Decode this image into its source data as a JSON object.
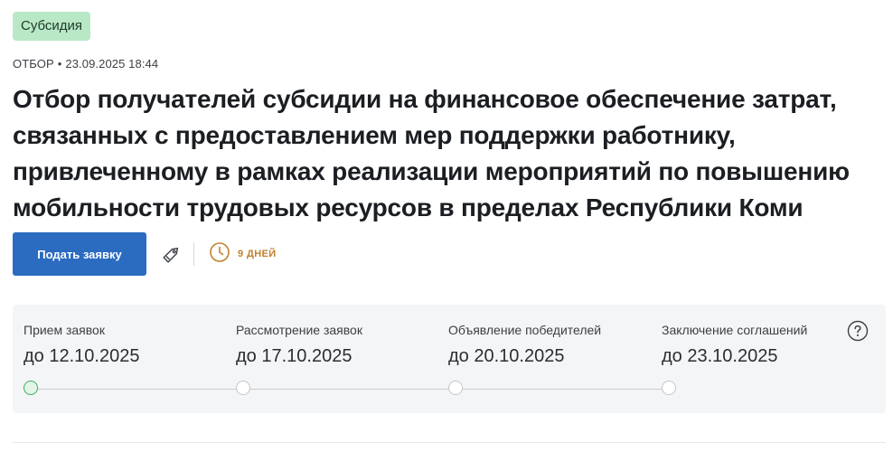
{
  "badge": {
    "label": "Субсидия",
    "color": "#b9e8c6"
  },
  "meta": {
    "type": "ОТБОР",
    "separator": "•",
    "datetime": "23.09.2025 18:44"
  },
  "title": "Отбор получателей субсидии на финансовое обеспечение затрат, связанных с предоставлением мер поддержки работнику, привлеченному в рамках реализации мероприятий по повышению мобильности трудовых ресурсов в пределах Республики Коми",
  "actions": {
    "apply_label": "Подать заявку",
    "apply_color": "#2b6bc0",
    "tag_icon": "tag-icon",
    "clock_icon": "clock-icon",
    "deadline_label": "9 ДНЕЙ",
    "deadline_color": "#c2802b"
  },
  "timeline": {
    "help_icon": "question-circle-icon",
    "active_color": "#3fae5c",
    "stages": [
      {
        "label": "Прием заявок",
        "date": "до 12.10.2025",
        "active": true
      },
      {
        "label": "Рассмотрение заявок",
        "date": "до 17.10.2025",
        "active": false
      },
      {
        "label": "Объявление победителей",
        "date": "до 20.10.2025",
        "active": false
      },
      {
        "label": "Заключение соглашений",
        "date": "до 23.10.2025",
        "active": false
      }
    ]
  }
}
